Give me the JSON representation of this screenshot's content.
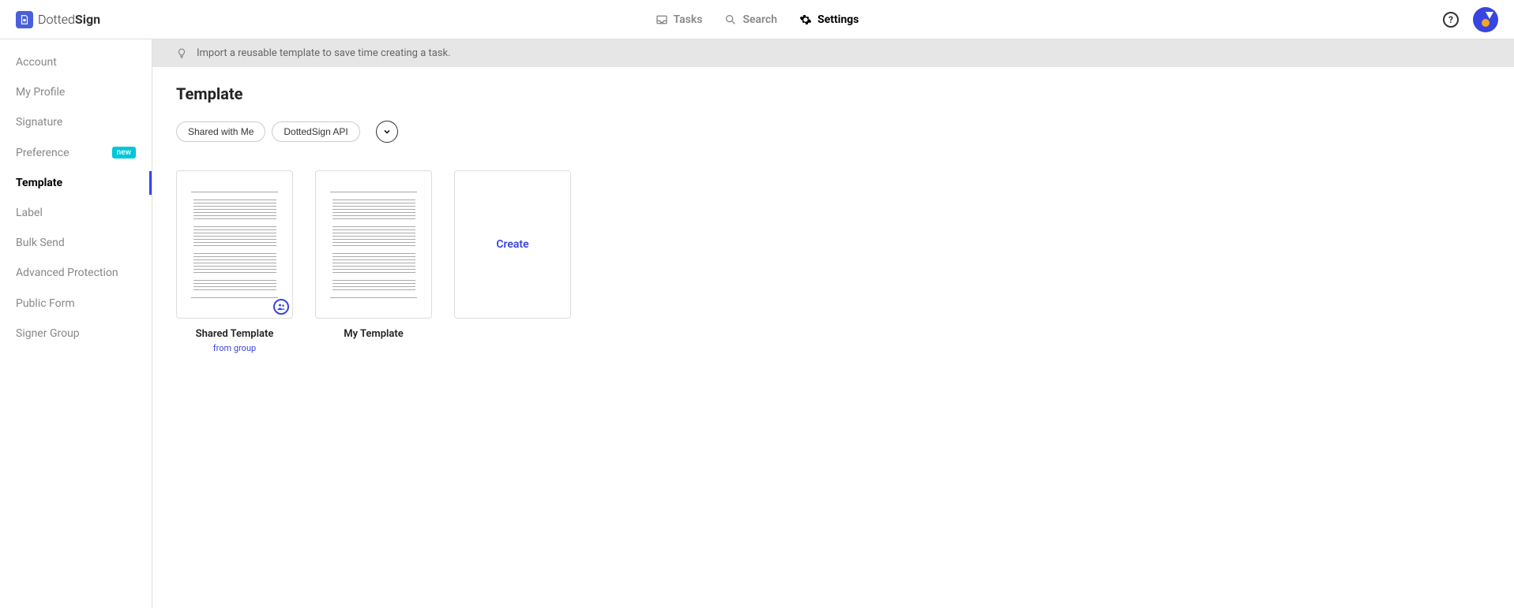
{
  "logo": {
    "name_thin": "Dotted",
    "name_bold": "Sign"
  },
  "header_nav": {
    "tasks": "Tasks",
    "search": "Search",
    "settings": "Settings"
  },
  "sidebar": {
    "items": [
      {
        "label": "Account",
        "active": false
      },
      {
        "label": "My Profile",
        "active": false
      },
      {
        "label": "Signature",
        "active": false
      },
      {
        "label": "Preference",
        "active": false,
        "badge": "new"
      },
      {
        "label": "Template",
        "active": true
      },
      {
        "label": "Label",
        "active": false
      },
      {
        "label": "Bulk Send",
        "active": false
      },
      {
        "label": "Advanced Protection",
        "active": false
      },
      {
        "label": "Public Form",
        "active": false
      },
      {
        "label": "Signer Group",
        "active": false
      }
    ]
  },
  "banner": {
    "text": "Import a reusable template to save time creating a task."
  },
  "page": {
    "title": "Template"
  },
  "filters": {
    "shared_with_me": "Shared with Me",
    "dottedsign_api": "DottedSign API"
  },
  "templates": [
    {
      "title": "Shared Template",
      "subtitle": "from group",
      "shared": true
    },
    {
      "title": "My Template",
      "subtitle": "",
      "shared": false
    }
  ],
  "create_label": "Create"
}
